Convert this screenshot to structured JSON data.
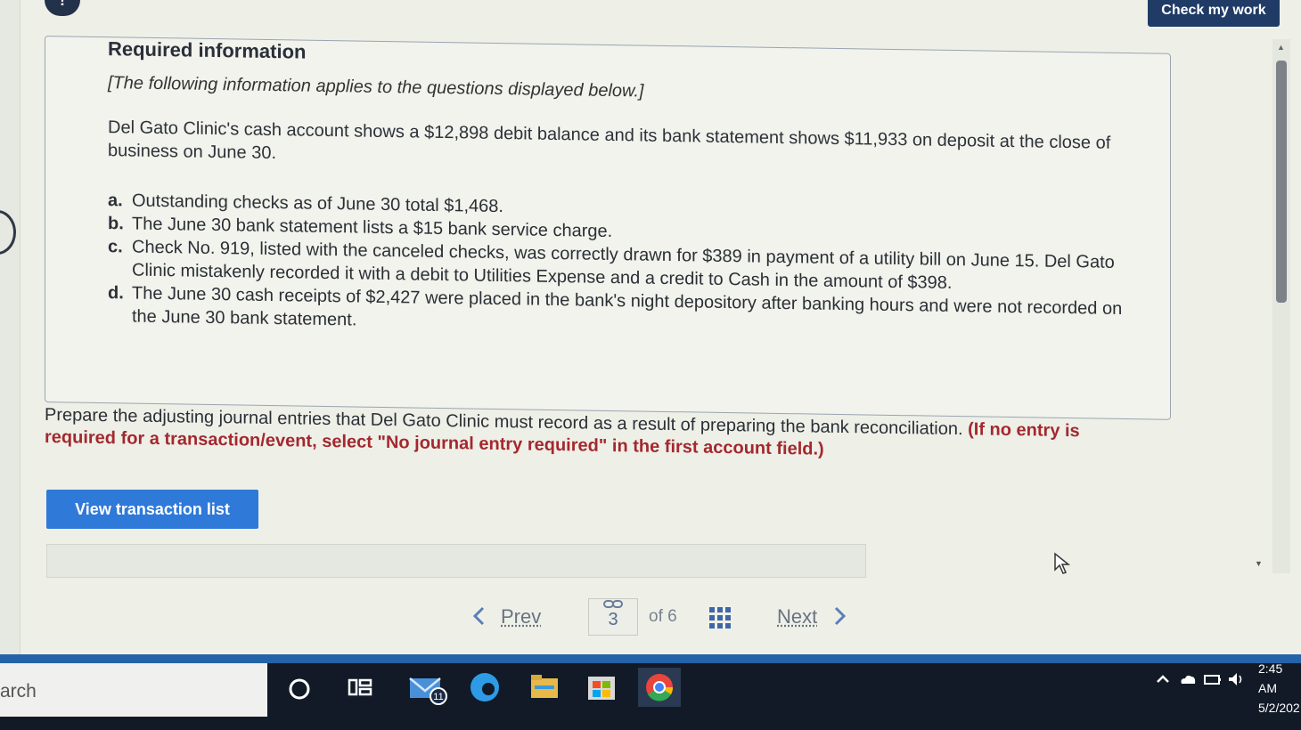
{
  "header": {
    "alert_badge": "!",
    "check_my_work": "Check my work"
  },
  "info": {
    "title": "Required information",
    "intro": "[The following information applies to the questions displayed below.]",
    "paragraph": "Del Gato Clinic's cash account shows a $12,898 debit balance and its bank statement shows $11,933 on deposit at the close of business on June 30.",
    "items": [
      {
        "letter": "a.",
        "text": "Outstanding checks as of June 30 total $1,468."
      },
      {
        "letter": "b.",
        "text": "The June 30 bank statement lists a $15 bank service charge."
      },
      {
        "letter": "c.",
        "text": "Check No. 919, listed with the canceled checks, was correctly drawn for $389 in payment of a utility bill on June 15. Del Gato Clinic mistakenly recorded it with a debit to Utilities Expense and a credit to Cash in the amount of $398."
      },
      {
        "letter": "d.",
        "text": "The June 30 cash receipts of $2,427 were placed in the bank's night depository after banking hours and were not recorded on the June 30 bank statement."
      }
    ]
  },
  "prompt": {
    "text": "Prepare the adjusting journal entries that Del Gato Clinic must record as a result of preparing the bank reconciliation.",
    "instruction": "(If no entry is required for a transaction/event, select \"No journal entry required\" in the first account field.)"
  },
  "actions": {
    "view_transaction_list": "View transaction list"
  },
  "pagination": {
    "prev": "Prev",
    "current": "3",
    "of_total": "of 6",
    "next": "Next"
  },
  "taskbar": {
    "search_text": "arch",
    "mail_badge": "11",
    "time": "2:45 AM",
    "date": "5/2/202"
  },
  "colors": {
    "accent_button": "#2f79d9",
    "check_button": "#1f3b66",
    "instruction_red": "#a4282e",
    "taskbar": "#111a26"
  }
}
